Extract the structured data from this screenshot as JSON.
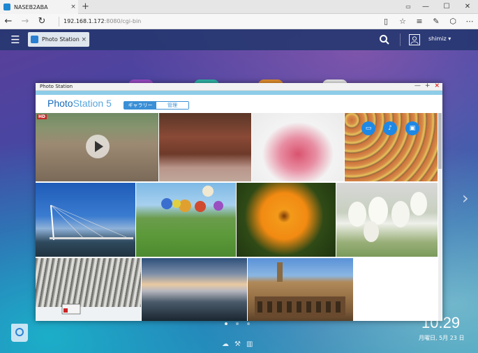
{
  "browser": {
    "tab_title": "NASEB2ABA",
    "tab_close": "×",
    "new_tab": "+",
    "window_list": "▭",
    "minimize": "—",
    "maximize": "☐",
    "close": "✕",
    "url_host": "192.168.1.172",
    "url_path": ":8080/cgi-bin"
  },
  "qts": {
    "app_tab_label": "Photo Station",
    "app_tab_close": "×",
    "username": "shimiz ▾",
    "clock": "10:29",
    "date": "月曜日, 5月 23 日",
    "page_dots": 3
  },
  "window": {
    "title": "Photo Station",
    "min": "—",
    "max": "+",
    "close": "×",
    "logo_photo": "Photo",
    "logo_station": "Station 5",
    "seg_gallery": "ギャラリー",
    "seg_manage": "管理",
    "hd_badge": "HD",
    "overlay_icons": [
      "monitor-icon",
      "music-icon",
      "slideshow-icon"
    ]
  },
  "colors": {
    "accent": "#3a8fd6",
    "qts_bar": "#23376e",
    "stripe": "#8ecde8"
  }
}
